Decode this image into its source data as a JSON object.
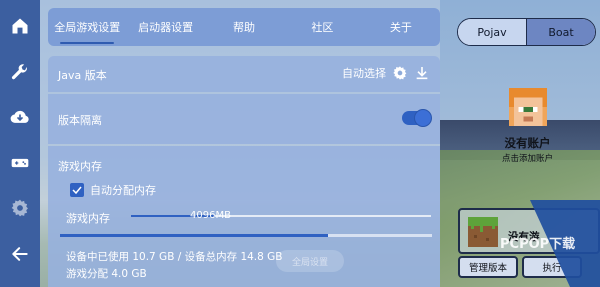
{
  "sidebar": {
    "items": [
      {
        "icon": "home-icon"
      },
      {
        "icon": "wrench-icon"
      },
      {
        "icon": "cloud-download-icon"
      },
      {
        "icon": "gamepad-icon"
      },
      {
        "icon": "gear-icon"
      },
      {
        "icon": "arrow-left-icon"
      }
    ]
  },
  "tabs": [
    {
      "label": "全局游戏设置",
      "active": true
    },
    {
      "label": "启动器设置",
      "active": false
    },
    {
      "label": "帮助",
      "active": false
    },
    {
      "label": "社区",
      "active": false
    },
    {
      "label": "关于",
      "active": false
    }
  ],
  "java": {
    "label": "Java 版本",
    "auto_select": "自动选择"
  },
  "isolation": {
    "label": "版本隔离",
    "enabled": true
  },
  "memory": {
    "title": "游戏内存",
    "auto_alloc_label": "自动分配内存",
    "auto_alloc_checked": true,
    "slider_label": "游戏内存",
    "slider_value": "4096MB",
    "slider_fraction": 0.28,
    "usage_fraction": 0.72,
    "device_info": "设备中已使用 10.7 GB / 设备总内存 14.8 GB",
    "game_alloc": "游戏分配 4.0 GB",
    "ghost_button": "全局设置"
  },
  "right_panel": {
    "segments": [
      {
        "label": "Pojav",
        "selected": true
      },
      {
        "label": "Boat",
        "selected": false
      }
    ],
    "account_name": "没有账户",
    "account_hint": "点击添加账户",
    "game_title": "没有游",
    "manage_button": "管理版本",
    "exec_button": "执行"
  },
  "watermark": {
    "text": "PCPOP下载"
  },
  "colors": {
    "rail": "#3c5fa0",
    "accent": "#2f61c2",
    "tab_bar": "#7d9dd6"
  }
}
